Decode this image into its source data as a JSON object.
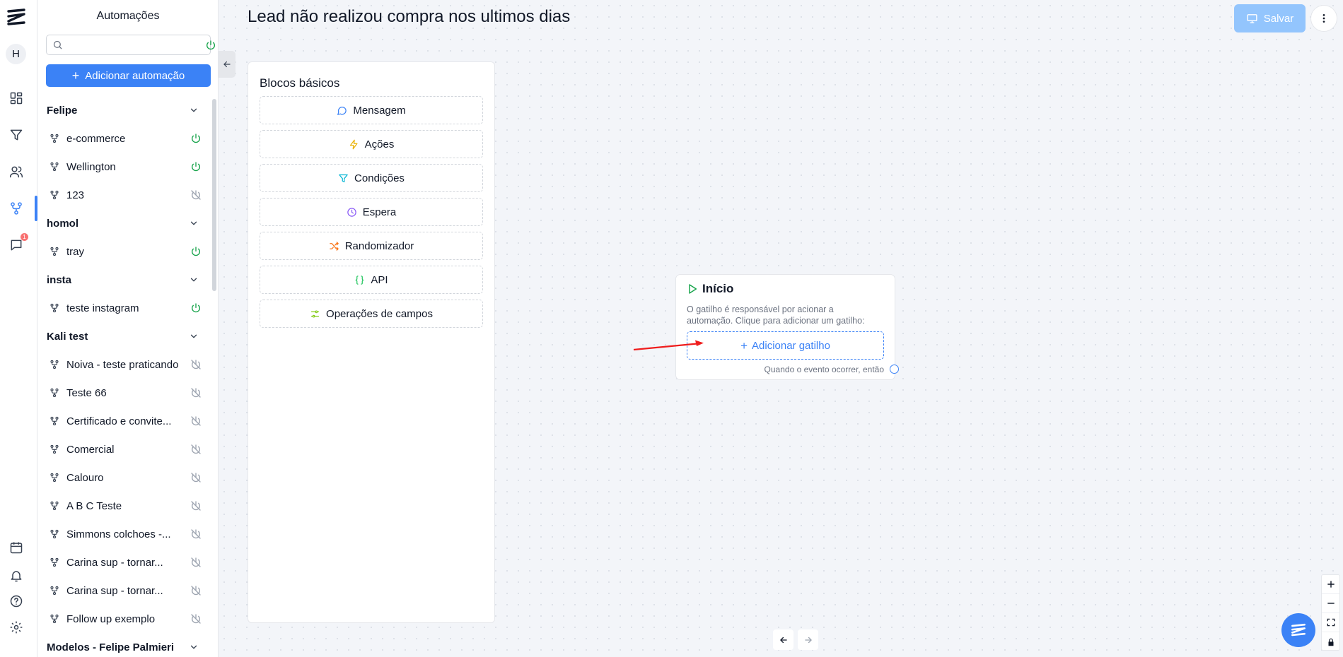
{
  "sidebar": {
    "title": "Automações",
    "search": {
      "value": "",
      "placeholder": ""
    },
    "add_button": "Adicionar automação",
    "groups": [
      {
        "name": "Felipe",
        "items": [
          {
            "label": "e-commerce",
            "active": true
          },
          {
            "label": "Wellington",
            "active": true
          },
          {
            "label": "123",
            "active": false
          }
        ]
      },
      {
        "name": "homol",
        "items": [
          {
            "label": "tray",
            "active": true
          }
        ]
      },
      {
        "name": "insta",
        "items": [
          {
            "label": "teste instagram",
            "active": true
          }
        ]
      },
      {
        "name": "Kali test",
        "items": [
          {
            "label": "Noiva - teste praticando",
            "active": false
          },
          {
            "label": "Teste 66",
            "active": false
          },
          {
            "label": "Certificado e convite...",
            "active": false
          },
          {
            "label": "Comercial",
            "active": false
          },
          {
            "label": "Calouro",
            "active": false
          },
          {
            "label": "A B C Teste",
            "active": false
          },
          {
            "label": "Simmons colchoes -...",
            "active": false
          },
          {
            "label": "Carina sup - tornar...",
            "active": false
          },
          {
            "label": "Carina sup - tornar...",
            "active": false
          },
          {
            "label": "Follow up exemplo",
            "active": false
          }
        ]
      },
      {
        "name": "Modelos - Felipe Palmieri",
        "items": []
      }
    ]
  },
  "rail": {
    "avatar_initial": "H",
    "notification_badge": "1",
    "icons": [
      "logo-icon",
      "dashboard-icon",
      "funnel-icon",
      "contacts-icon",
      "automations-icon",
      "chat-icon",
      "calendar-icon",
      "bell-icon",
      "help-icon",
      "settings-icon"
    ],
    "accent": "#3b82f6"
  },
  "header": {
    "title": "Lead não realizou compra nos ultimos dias",
    "save_label": "Salvar"
  },
  "blocks": {
    "title": "Blocos básicos",
    "items": [
      {
        "label": "Mensagem",
        "icon": "message-circle-icon",
        "color": "#3b82f6"
      },
      {
        "label": "Ações",
        "icon": "zap-icon",
        "color": "#eab308"
      },
      {
        "label": "Condições",
        "icon": "filter-icon",
        "color": "#06b6d4"
      },
      {
        "label": "Espera",
        "icon": "clock-icon",
        "color": "#8b5cf6"
      },
      {
        "label": "Randomizador",
        "icon": "shuffle-icon",
        "color": "#f97316"
      },
      {
        "label": "API",
        "icon": "braces-icon",
        "color": "#22c55e"
      },
      {
        "label": "Operações de campos",
        "icon": "sliders-icon",
        "color": "#84cc16"
      }
    ]
  },
  "start_node": {
    "title": "Início",
    "description": "O gatilho é responsável por acionar a automação. Clique para adicionar um gatilho:",
    "add_trigger": "Adicionar gatilho",
    "footer": "Quando o evento ocorrer, então"
  },
  "colors": {
    "primary": "#3b82f6",
    "success": "#16a34a",
    "annotation_arrow": "#ef1d1d"
  }
}
